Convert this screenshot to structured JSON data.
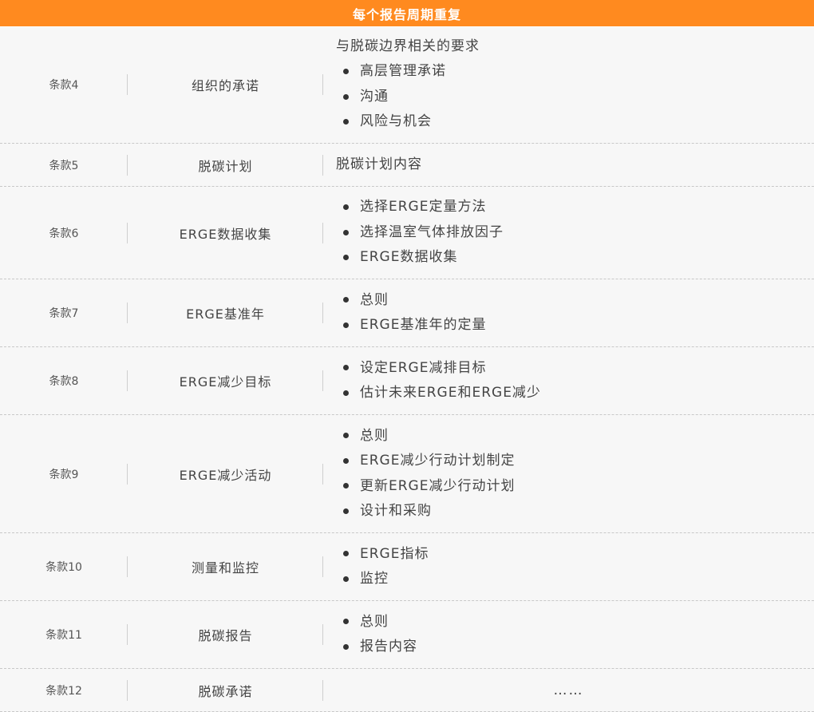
{
  "title": "每个报告周期重复",
  "rows": [
    {
      "clause": "条款4",
      "topic": "组织的承诺",
      "heading": "与脱碳边界相关的要求",
      "items": [
        "高层管理承诺",
        "沟通",
        "风险与机会"
      ]
    },
    {
      "clause": "条款5",
      "topic": "脱碳计划",
      "heading": "脱碳计划内容",
      "items": []
    },
    {
      "clause": "条款6",
      "topic": "ERGE数据收集",
      "heading": "",
      "items": [
        "选择ERGE定量方法",
        "选择温室气体排放因子",
        "ERGE数据收集"
      ]
    },
    {
      "clause": "条款7",
      "topic": "ERGE基准年",
      "heading": "",
      "items": [
        "总则",
        "ERGE基准年的定量"
      ]
    },
    {
      "clause": "条款8",
      "topic": "ERGE减少目标",
      "heading": "",
      "items": [
        "设定ERGE减排目标",
        "估计未来ERGE和ERGE减少"
      ]
    },
    {
      "clause": "条款9",
      "topic": "ERGE减少活动",
      "heading": "",
      "items": [
        "总则",
        "ERGE减少行动计划制定",
        "更新ERGE减少行动计划",
        "设计和采购"
      ]
    },
    {
      "clause": "条款10",
      "topic": "测量和监控",
      "heading": "",
      "items": [
        "ERGE指标",
        "监控"
      ]
    },
    {
      "clause": "条款11",
      "topic": "脱碳报告",
      "heading": "",
      "items": [
        "总则",
        "报告内容"
      ]
    },
    {
      "clause": "条款12",
      "topic": "脱碳承诺",
      "heading": "",
      "items": [],
      "ellipsis": "……"
    }
  ],
  "colors": {
    "header_bg": "#ff8a1f",
    "header_text": "#ffffff",
    "row_bg": "#f7f7f7",
    "divider": "#c8c8c8"
  }
}
